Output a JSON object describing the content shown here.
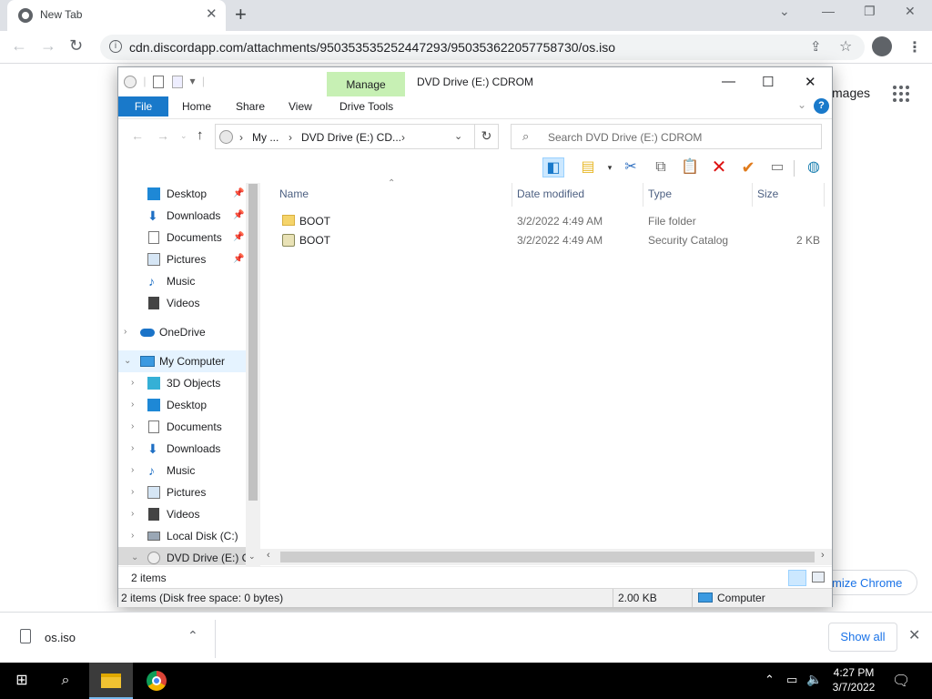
{
  "browser": {
    "tab_title": "New Tab",
    "url": "cdn.discordapp.com/attachments/950353535252447293/950353622057758730/os.iso",
    "bg_images_link": "mages",
    "bg_customize": "mize Chrome"
  },
  "explorer": {
    "manage_label": "Manage",
    "title": "DVD Drive (E:) CDROM",
    "ribbon_tabs": {
      "file": "File",
      "home": "Home",
      "share": "Share",
      "view": "View",
      "drive_tools": "Drive Tools"
    },
    "address": {
      "crumb1": "My ...",
      "crumb2": "DVD Drive (E:) CD..."
    },
    "search_placeholder": "Search DVD Drive (E:) CDROM",
    "nav": {
      "quick": [
        {
          "label": "Desktop"
        },
        {
          "label": "Downloads"
        },
        {
          "label": "Documents"
        },
        {
          "label": "Pictures"
        },
        {
          "label": "Music"
        },
        {
          "label": "Videos"
        }
      ],
      "onedrive": "OneDrive",
      "computer": "My Computer",
      "computer_items": [
        {
          "label": "3D Objects"
        },
        {
          "label": "Desktop"
        },
        {
          "label": "Documents"
        },
        {
          "label": "Downloads"
        },
        {
          "label": "Music"
        },
        {
          "label": "Pictures"
        },
        {
          "label": "Videos"
        },
        {
          "label": "Local Disk (C:)"
        },
        {
          "label": "DVD Drive (E:) CI"
        }
      ]
    },
    "columns": {
      "name": "Name",
      "date": "Date modified",
      "type": "Type",
      "size": "Size"
    },
    "files": [
      {
        "name": "BOOT",
        "date": "3/2/2022 4:49 AM",
        "type": "File folder",
        "size": ""
      },
      {
        "name": "BOOT",
        "date": "3/2/2022 4:49 AM",
        "type": "Security Catalog",
        "size": "2 KB"
      }
    ],
    "item_count": "2 items",
    "status_left": "2 items (Disk free space: 0 bytes)",
    "status_size": "2.00 KB",
    "status_location": "Computer"
  },
  "downloads": {
    "file": "os.iso",
    "show_all": "Show all"
  },
  "taskbar": {
    "time": "4:27 PM",
    "date": "3/7/2022"
  }
}
